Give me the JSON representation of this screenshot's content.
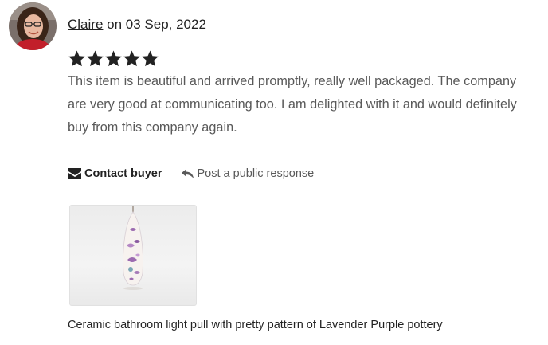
{
  "review": {
    "reviewer_name": "Claire",
    "date_prefix": " on ",
    "date": "03 Sep, 2022",
    "rating": 5,
    "rating_max": 5,
    "text": "This item is beautiful and arrived promptly, really well packaged. The company are very good at communicating too. I am delighted with it and would definitely buy from this company again."
  },
  "actions": {
    "contact_label": "Contact buyer",
    "public_response_label": "Post a public response"
  },
  "product": {
    "caption": "Ceramic bathroom light pull with pretty pattern of Lavender Purple pottery"
  },
  "icons": {
    "star": "star-icon",
    "contact": "envelope-icon",
    "reply": "reply-arrow-icon"
  },
  "colors": {
    "text_primary": "#222222",
    "text_secondary": "#595959",
    "star": "#222222",
    "lavender": "#9c6bb0"
  }
}
